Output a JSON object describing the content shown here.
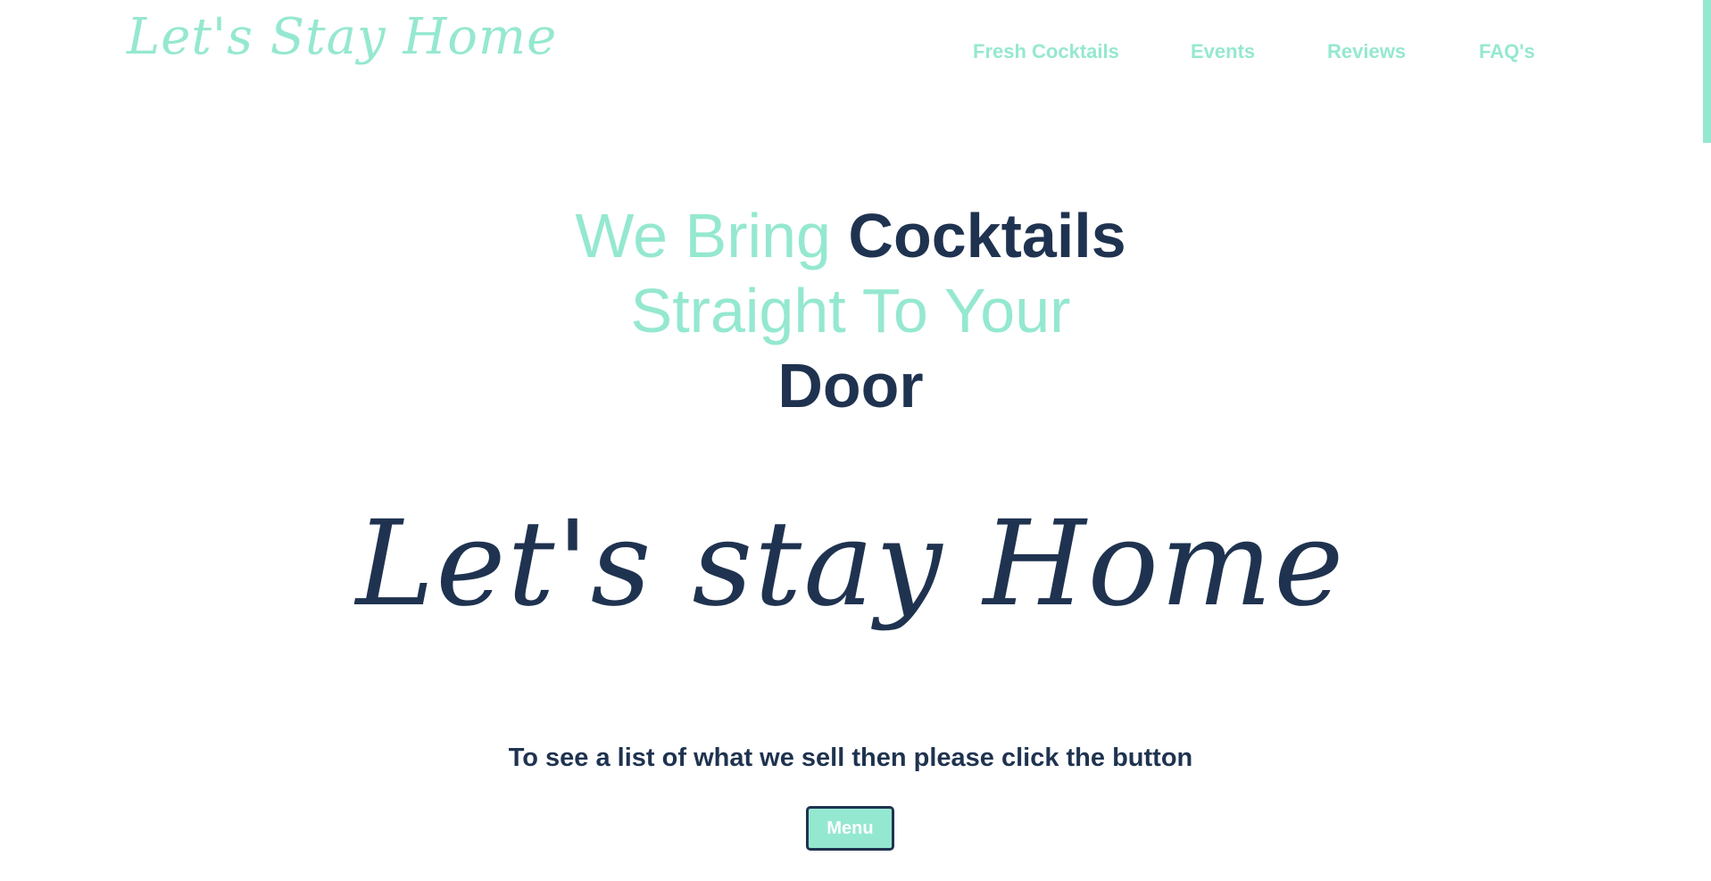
{
  "header": {
    "logo": "Let's Stay Home",
    "nav": [
      {
        "label": "Fresh Cocktails"
      },
      {
        "label": "Events"
      },
      {
        "label": "Reviews"
      },
      {
        "label": "FAQ's"
      }
    ]
  },
  "hero": {
    "line1_light": "We Bring",
    "line1_dark": "Cocktails",
    "line2_light": "Straight To Your",
    "line3_dark": "Door",
    "script_title": "Let's stay Home",
    "instruction": "To see a list of what we sell then please click the button",
    "button_label": "Menu"
  },
  "colors": {
    "accent": "#95e8d0",
    "navy": "#1f3350",
    "background": "#ffffff"
  }
}
